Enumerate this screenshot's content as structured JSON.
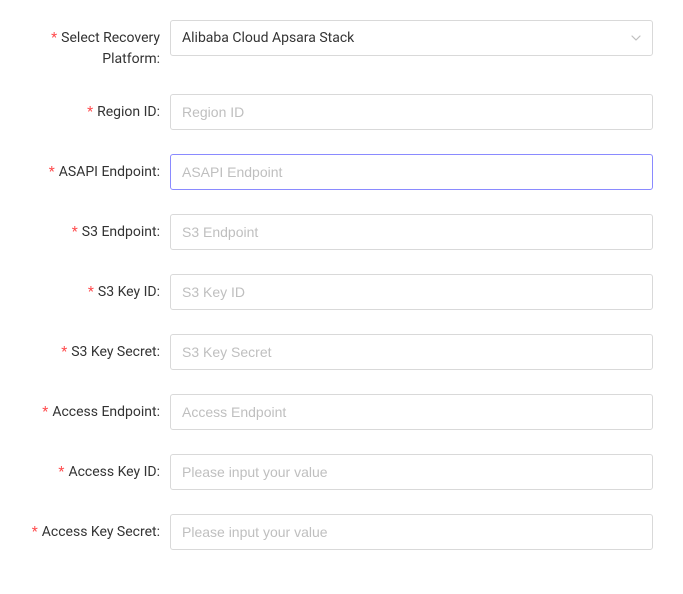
{
  "form": {
    "recoveryPlatform": {
      "label": "Select Recovery Platform:",
      "value": "Alibaba Cloud Apsara Stack"
    },
    "regionId": {
      "label": "Region ID:",
      "placeholder": "Region ID",
      "value": ""
    },
    "asapiEndpoint": {
      "label": "ASAPI Endpoint:",
      "placeholder": "ASAPI Endpoint",
      "value": ""
    },
    "s3Endpoint": {
      "label": "S3 Endpoint:",
      "placeholder": "S3 Endpoint",
      "value": ""
    },
    "s3KeyId": {
      "label": "S3 Key ID:",
      "placeholder": "S3 Key ID",
      "value": ""
    },
    "s3KeySecret": {
      "label": "S3 Key Secret:",
      "placeholder": "S3 Key Secret",
      "value": ""
    },
    "accessEndpoint": {
      "label": "Access Endpoint:",
      "placeholder": "Access Endpoint",
      "value": ""
    },
    "accessKeyId": {
      "label": "Access Key ID:",
      "placeholder": "Please input your value",
      "value": ""
    },
    "accessKeySecret": {
      "label": "Access Key Secret:",
      "placeholder": "Please input your value",
      "value": ""
    }
  }
}
